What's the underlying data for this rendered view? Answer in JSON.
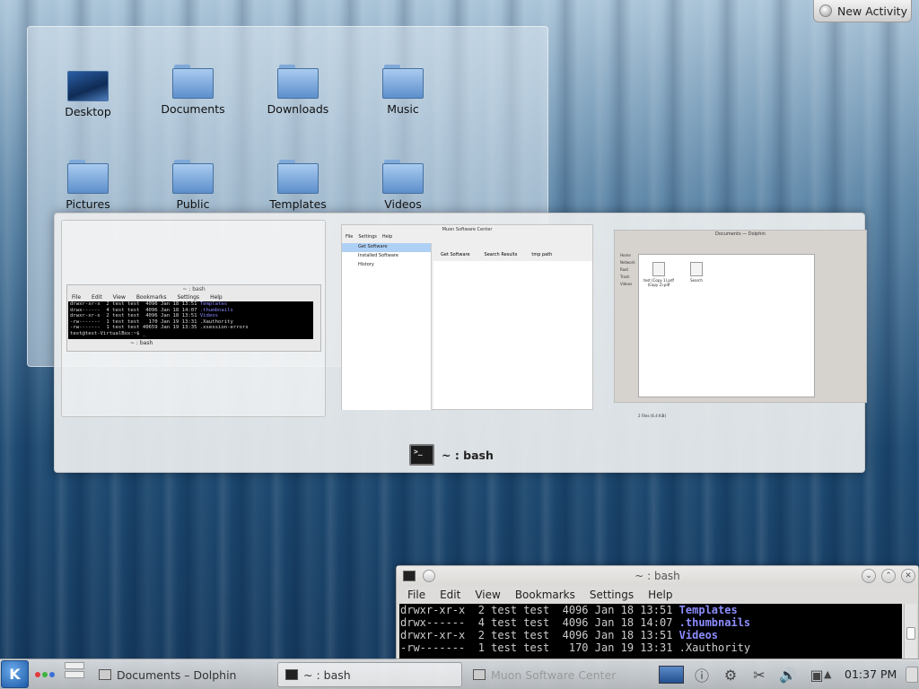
{
  "new_activity": {
    "label": "New Activity"
  },
  "folderview": {
    "items": [
      {
        "label": "Desktop"
      },
      {
        "label": "Documents"
      },
      {
        "label": "Downloads"
      },
      {
        "label": "Music"
      },
      {
        "label": "Pictures"
      },
      {
        "label": "Public"
      },
      {
        "label": "Templates"
      },
      {
        "label": "Videos"
      }
    ]
  },
  "switcher": {
    "caption": "~ : bash",
    "konsole_thumb": {
      "title": "~ : bash",
      "menu": [
        "File",
        "Edit",
        "View",
        "Bookmarks",
        "Settings",
        "Help"
      ],
      "lines": [
        {
          "text": "drwxr-xr-x  2 test test  4096 Jan 18 13:51 ",
          "name": "Templates"
        },
        {
          "text": "drwx------  4 test test  4096 Jan 18 14:07 ",
          "name": ".thumbnails"
        },
        {
          "text": "drwxr-xr-x  2 test test  4096 Jan 18 13:51 ",
          "name": "Videos"
        },
        {
          "text": "-rw-------  1 test test   170 Jan 19 13:31 .Xauthority",
          "name": ""
        },
        {
          "text": "-rw-------  1 test test 40659 Jan 19 13:35 .xsession-errors",
          "name": ""
        },
        {
          "text": "test@test-VirtualBox:~$ _",
          "name": ""
        }
      ],
      "tab": "~ : bash"
    },
    "muon_thumb": {
      "title": "Muon Software Center",
      "menu": [
        "File",
        "Settings",
        "Help"
      ],
      "sidebar": [
        "Get Software",
        "Installed Software",
        "History"
      ],
      "toolbar": [
        "Get Software",
        "Search Results"
      ],
      "search_value": "tmp path"
    },
    "dolphin_thumb": {
      "title": "Documents — Dolphin",
      "places": [
        "Home",
        "Network",
        "Root",
        "Trash",
        "Videos"
      ],
      "files": [
        "test (Copy 1).pdf (Copy 2).pdf",
        "Search"
      ],
      "status": "2 Files (6.4 KiB)"
    }
  },
  "konsole": {
    "title": "~ : bash",
    "menu": [
      "File",
      "Edit",
      "View",
      "Bookmarks",
      "Settings",
      "Help"
    ],
    "lines": [
      {
        "text": "drwxr-xr-x  2 test test  4096 Jan 18 13:51 ",
        "name": "Templates"
      },
      {
        "text": "drwx------  4 test test  4096 Jan 18 14:07 ",
        "name": ".thumbnails"
      },
      {
        "text": "drwxr-xr-x  2 test test  4096 Jan 18 13:51 ",
        "name": "Videos"
      },
      {
        "text": "-rw-------  1 test test   170 Jan 19 13:31 .Xauthority",
        "name": ""
      }
    ]
  },
  "panel": {
    "tasks": [
      {
        "label": "Documents – Dolphin"
      },
      {
        "label": "~ : bash"
      },
      {
        "label": "Muon Software Center"
      }
    ],
    "clock": "01:37 PM",
    "activity_dot_colors": [
      "#e23b3b",
      "#3db33d",
      "#3a6fd8"
    ]
  }
}
